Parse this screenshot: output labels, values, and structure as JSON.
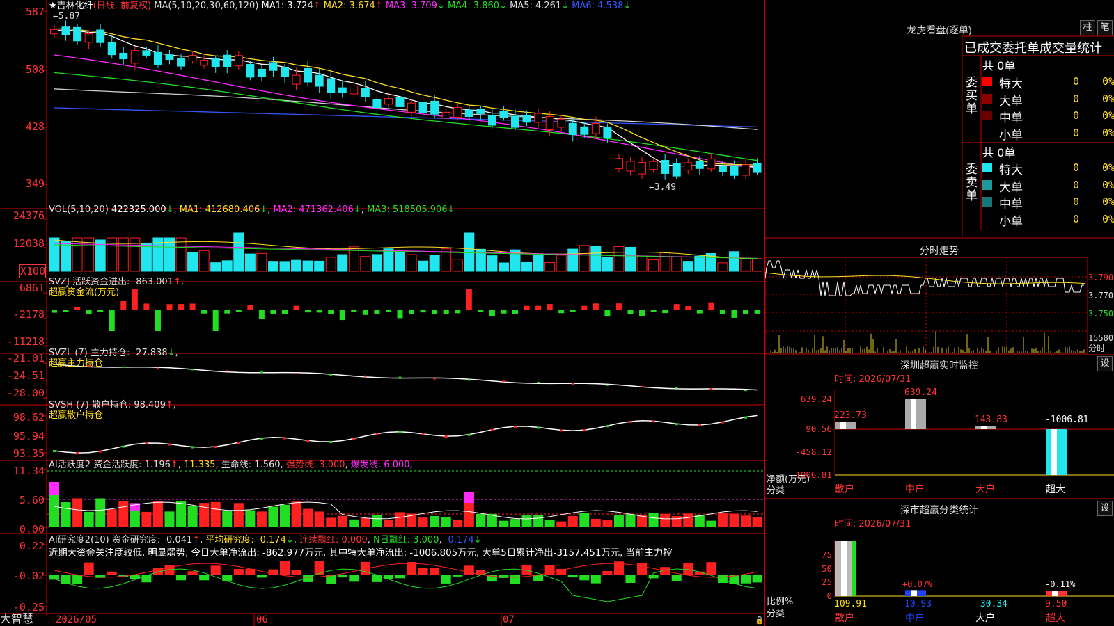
{
  "colors": {
    "up": "#ff2020",
    "down": "#22e6ee",
    "green": "#22dd22",
    "magenta": "#ff2bff",
    "yellow": "#ffdd22",
    "white": "#ffffff",
    "grid": "#8b0000"
  },
  "kline": {
    "title": "吉林化纤",
    "mode": "(日线, 前复权)",
    "ma_params": "MA(5,10,20,30,60,120)",
    "ma": [
      {
        "label": "MA1: 3.724",
        "arrow": "↑",
        "color": "#ffffff"
      },
      {
        "label": "MA2: 3.674",
        "arrow": "↑",
        "color": "#ffdd22"
      },
      {
        "label": "MA3: 3.709",
        "arrow": "↓",
        "color": "#ff2bff"
      },
      {
        "label": "MA4: 3.860",
        "arrow": "↓",
        "color": "#22dd22"
      },
      {
        "label": "MA5: 4.261",
        "arrow": "↓",
        "color": "#dddddd"
      },
      {
        "label": "MA6: 4.538",
        "arrow": "↓",
        "color": "#3355ff"
      }
    ],
    "y_ticks": [
      "587",
      "508",
      "428",
      "349"
    ],
    "high_marker": "5.87",
    "low_marker": "3.49"
  },
  "vol": {
    "header": "VOL(5,10,20)",
    "value": "422325.000",
    "ma1": "MA1: 412680.406",
    "ma2": "MA2: 471362.406",
    "ma3": "MA3: 518505.906",
    "y_ticks": [
      "24376",
      "12038"
    ],
    "unit": "X100"
  },
  "svzj": {
    "header": "SVZJ  活跃资金进出: -863.001",
    "sub": "超赢资金流(万元)",
    "y_ticks": [
      "6861",
      "-2178",
      "-11218"
    ]
  },
  "svzl": {
    "header": "SVZL (7) 主力持仓: -27.838",
    "sub": "超赢主力持仓",
    "y_ticks": [
      "-21.01",
      "-24.51",
      "-28.00"
    ]
  },
  "svsh": {
    "header": "SVSH (7) 散户持仓: 98.409",
    "sub": "超赢散户持仓",
    "y_ticks": [
      "98.62",
      "95.94",
      "93.35"
    ]
  },
  "ai_active": {
    "header": "AI活跃度2 资金活跃度: 1.196",
    "v2": "11.335",
    "v3": "生命线: 1.560",
    "v4": "强势线: 3.000",
    "v5": "爆发线: 6.000",
    "y_ticks": [
      "11.34",
      "5.60",
      "0.00"
    ]
  },
  "ai_research": {
    "header": "AI研究度2(10) 资金研究度: -0.041",
    "avg": "平均研究度: -0.174",
    "red": "连续飘红: 0.000",
    "nred": "N日飘红: 3.000",
    "last": "-0.174",
    "text": "近期大资金关注度较低, 明显弱势, 今日大单净流出: -862.977万元, 其中特大单净流出: -1006.805万元, 大单5日累计净出-3157.451万元, 当前主力控",
    "y_ticks": [
      "0.22",
      "-0.02",
      "-0.25"
    ]
  },
  "dates": [
    "2026/05",
    "06",
    "07"
  ],
  "brand": "大智慧",
  "longhu": {
    "title": "龙虎看盘(逐单)",
    "btn1": "柱",
    "btn2": "笔",
    "subtitle": "已成交委托单成交量统计",
    "buy_label": "委买单",
    "sell_label": "委卖单",
    "buy_total": "共 0单",
    "sell_total": "共 0单",
    "buy_rows": [
      {
        "name": "特大",
        "count": "0",
        "pct": "0%",
        "color": "#ff0000"
      },
      {
        "name": "大单",
        "count": "0",
        "pct": "0%",
        "color": "#8b0000"
      },
      {
        "name": "中单",
        "count": "0",
        "pct": "0%",
        "color": "#6a0000"
      },
      {
        "name": "小单",
        "count": "0",
        "pct": "0%",
        "color": ""
      }
    ],
    "sell_rows": [
      {
        "name": "特大",
        "count": "0",
        "pct": "0%",
        "color": "#22e6ee"
      },
      {
        "name": "大单",
        "count": "0",
        "pct": "0%",
        "color": "#1a9a9a"
      },
      {
        "name": "中单",
        "count": "0",
        "pct": "0%",
        "color": "#147878"
      },
      {
        "name": "小单",
        "count": "0",
        "pct": "0%",
        "color": ""
      }
    ]
  },
  "intraday": {
    "title": "分时走势",
    "prices": [
      "3.790",
      "3.770",
      "3.750"
    ],
    "vol_top": "15580",
    "vol_label": "分时"
  },
  "monitor": {
    "title": "深圳超赢实时监控",
    "btn": "设",
    "time": "时间: 2026/07/31",
    "y_ticks": [
      "639.24",
      "90.56",
      "-458.12",
      "-1006.81"
    ],
    "unit": "净额(万元)",
    "cat_label": "分类",
    "categories": [
      "散户",
      "中户",
      "大户",
      "超大"
    ],
    "values": [
      223.73,
      639.24,
      143.83,
      -1006.81
    ],
    "value_labels": [
      "223.73",
      "639.24",
      "143.83",
      "-1006.81"
    ]
  },
  "classify": {
    "title": "深市超赢分类统计",
    "btn": "设",
    "time": "时间: 2026/07/31",
    "y_ticks": [
      "75",
      "50",
      "25",
      "0"
    ],
    "ratio_label": "比例%",
    "cat_label": "分类",
    "categories": [
      "散户",
      "中户",
      "大户",
      "超大"
    ],
    "values": [
      109.91,
      10.93,
      -30.34,
      9.5
    ],
    "value_labels": [
      "109.91",
      "10.93",
      "-30.34",
      "9.50"
    ],
    "bar_labels": [
      "+0.07%",
      "-0.11%"
    ]
  }
}
